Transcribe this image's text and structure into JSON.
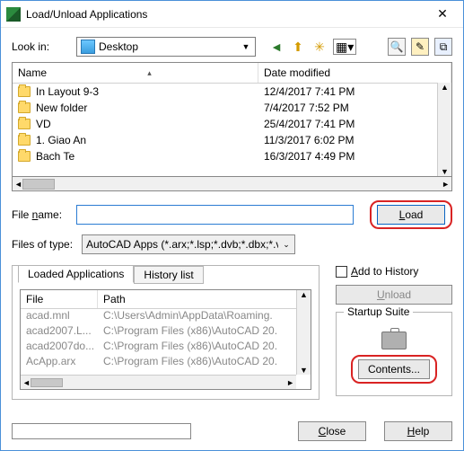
{
  "window": {
    "title": "Load/Unload Applications"
  },
  "lookin": {
    "label": "Look in:",
    "value": "Desktop"
  },
  "nav_icons": {
    "back": "back-arrow-icon",
    "up": "up-folder-icon",
    "new": "new-folder-icon",
    "views": "views-icon"
  },
  "tool_icons": {
    "search": "search-icon",
    "tools": "tools-icon",
    "extra": "extra-icon"
  },
  "file_list": {
    "columns": {
      "name": "Name",
      "date": "Date modified"
    },
    "rows": [
      {
        "name": "In Layout 9-3",
        "date": "12/4/2017 7:41 PM"
      },
      {
        "name": "New folder",
        "date": "7/4/2017 7:52 PM"
      },
      {
        "name": "VD",
        "date": "25/4/2017 7:41 PM"
      },
      {
        "name": "1. Giao An",
        "date": "11/3/2017 6:02 PM"
      },
      {
        "name": "Bach Te",
        "date": "16/3/2017 4:49 PM"
      }
    ]
  },
  "filename": {
    "label_pre": "File ",
    "label_u": "n",
    "label_post": "ame:",
    "value": ""
  },
  "filetype": {
    "label": "Files of type:",
    "value": "AutoCAD Apps (*.arx;*.lsp;*.dvb;*.dbx;*.vlx;*."
  },
  "buttons": {
    "load_u": "L",
    "load_post": "oad",
    "unload_u": "U",
    "unload_post": "nload",
    "contents": "Contents...",
    "close_u": "C",
    "close_post": "lose",
    "help_u": "H",
    "help_post": "elp"
  },
  "tabs": {
    "loaded": "Loaded Applications",
    "history": "History list"
  },
  "loaded_list": {
    "columns": {
      "file": "File",
      "path": "Path"
    },
    "rows": [
      {
        "file": "acad.mnl",
        "path": "C:\\Users\\Admin\\AppData\\Roaming."
      },
      {
        "file": "acad2007.L...",
        "path": "C:\\Program Files (x86)\\AutoCAD 20."
      },
      {
        "file": "acad2007do...",
        "path": "C:\\Program Files (x86)\\AutoCAD 20."
      },
      {
        "file": "AcApp.arx",
        "path": "C:\\Program Files (x86)\\AutoCAD 20."
      }
    ]
  },
  "add_history": {
    "label_u": "A",
    "label_post": "dd to History"
  },
  "startup": {
    "legend": "Startup Suite"
  }
}
